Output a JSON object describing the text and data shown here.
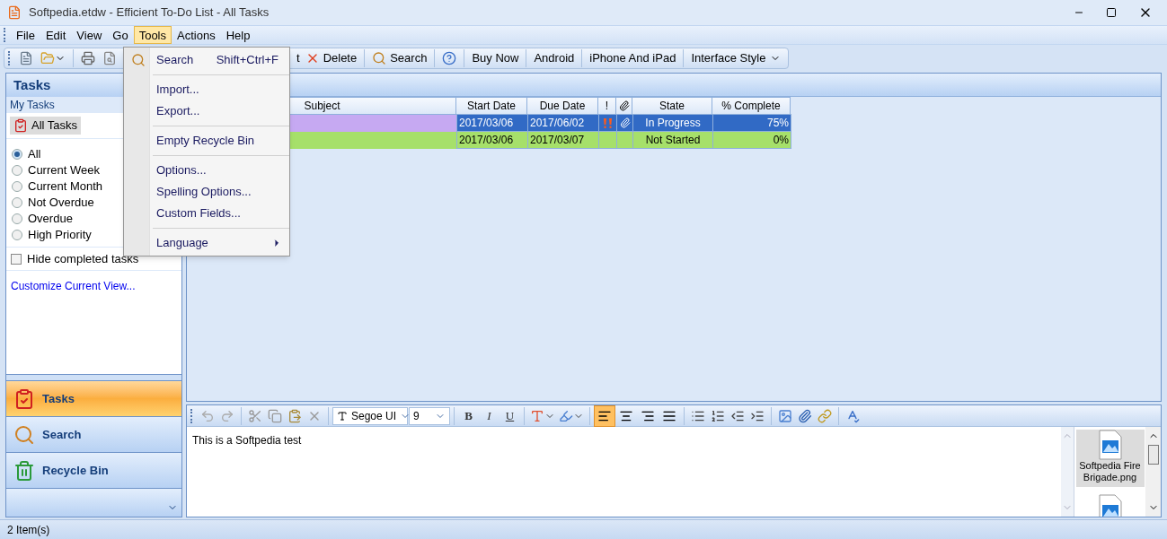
{
  "window": {
    "title": "Softpedia.etdw - Efficient To-Do List - All Tasks"
  },
  "menu_bar": [
    {
      "label": "File",
      "selected": false
    },
    {
      "label": "Edit",
      "selected": false
    },
    {
      "label": "View",
      "selected": false
    },
    {
      "label": "Go",
      "selected": false
    },
    {
      "label": "Tools",
      "selected": true
    },
    {
      "label": "Actions",
      "selected": false
    },
    {
      "label": "Help",
      "selected": false
    }
  ],
  "toolbar": {
    "partial_button": "t",
    "buttons": [
      {
        "label": "Delete",
        "kind": "delete"
      },
      {
        "label": "Search",
        "kind": "search"
      },
      {
        "kind": "help"
      },
      {
        "label": "Buy Now",
        "kind": "text"
      },
      {
        "label": "Android",
        "kind": "text"
      },
      {
        "label": "iPhone And iPad",
        "kind": "text"
      },
      {
        "label": "Interface Style",
        "kind": "dropdown"
      }
    ]
  },
  "tools_menu": [
    {
      "kind": "item",
      "label": "Search",
      "shortcut": "Shift+Ctrl+F",
      "icon": true
    },
    {
      "kind": "separator"
    },
    {
      "kind": "item",
      "label": "Import..."
    },
    {
      "kind": "item",
      "label": "Export..."
    },
    {
      "kind": "separator"
    },
    {
      "kind": "item",
      "label": "Empty Recycle Bin"
    },
    {
      "kind": "separator"
    },
    {
      "kind": "item",
      "label": "Options..."
    },
    {
      "kind": "item",
      "label": "Spelling Options..."
    },
    {
      "kind": "item",
      "label": "Custom Fields..."
    },
    {
      "kind": "separator"
    },
    {
      "kind": "submenu",
      "label": "Language"
    }
  ],
  "sidebar": {
    "title": "Tasks",
    "section": "My Tasks",
    "view_button": "All Tasks",
    "filters": [
      {
        "label": "All",
        "selected": true
      },
      {
        "label": "Current Week",
        "selected": false
      },
      {
        "label": "Current Month",
        "selected": false
      },
      {
        "label": "Not Overdue",
        "selected": false
      },
      {
        "label": "Overdue",
        "selected": false
      },
      {
        "label": "High Priority",
        "selected": false
      }
    ],
    "hide_completed": {
      "label": "Hide completed tasks",
      "checked": false
    },
    "customize_link": "Customize Current View...",
    "nav": [
      {
        "label": "Tasks",
        "kind": "tasks",
        "selected": true
      },
      {
        "label": "Search",
        "kind": "search",
        "selected": false
      },
      {
        "label": "Recycle Bin",
        "kind": "recycle",
        "selected": false
      }
    ]
  },
  "table": {
    "columns": [
      {
        "label": "Subject",
        "kind": "text"
      },
      {
        "label": "Start Date",
        "kind": "text"
      },
      {
        "label": "Due Date",
        "kind": "text"
      },
      {
        "label": "!",
        "kind": "text"
      },
      {
        "kind": "attachment"
      },
      {
        "label": "State",
        "kind": "text"
      },
      {
        "label": "% Complete",
        "kind": "text"
      }
    ],
    "rows": [
      {
        "selected": true,
        "color": "#c6a9f2",
        "start": "2017/03/06",
        "due": "2017/06/02",
        "high_priority": true,
        "attachment": true,
        "state": "In Progress",
        "complete": "75%"
      },
      {
        "selected": false,
        "color": "#a6e06a",
        "start": "2017/03/06",
        "due": "2017/03/07",
        "high_priority": false,
        "attachment": false,
        "state": "Not Started",
        "complete": "0%"
      }
    ]
  },
  "editor": {
    "font": "Segoe UI",
    "size": "9",
    "format_buttons": [
      "B",
      "I",
      "U"
    ],
    "alignments": [
      {
        "kind": "left",
        "selected": true
      },
      {
        "kind": "center",
        "selected": false
      },
      {
        "kind": "right",
        "selected": false
      },
      {
        "kind": "justify",
        "selected": false
      }
    ],
    "text": "This is a Softpedia test",
    "attachments": [
      {
        "name": "Softpedia Fire Brigade.png",
        "selected": true
      },
      {
        "selected": false
      }
    ]
  },
  "status_bar": "2 Item(s)"
}
